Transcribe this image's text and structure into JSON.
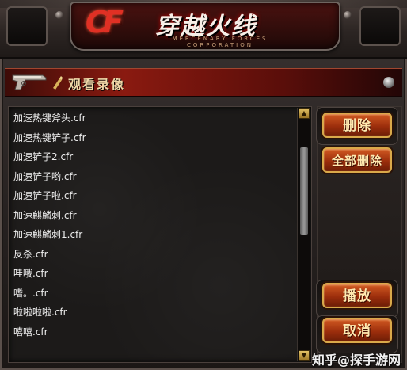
{
  "logo": {
    "cf": "CF",
    "title": "穿越火线",
    "subtitle": "MERCENARY FORCES CORPORATION"
  },
  "window": {
    "title": "观看录像"
  },
  "recordings": [
    "加速热键斧头.cfr",
    "加速热键铲子.cfr",
    "加速铲子2.cfr",
    "加速铲子哟.cfr",
    "加速铲子啦.cfr",
    "加速麒麟刺.cfr",
    "加速麒麟刺1.cfr",
    "反杀.cfr",
    "哇哦.cfr",
    "嗜。.cfr",
    "啦啦啦啦.cfr",
    "嘻嘻.cfr"
  ],
  "scrollbar": {
    "up": "▲",
    "down": "▼"
  },
  "buttons": {
    "delete": "删除",
    "delete_all": "全部删除",
    "play": "播放",
    "cancel": "取消"
  },
  "watermark": "知乎@探手游网"
}
